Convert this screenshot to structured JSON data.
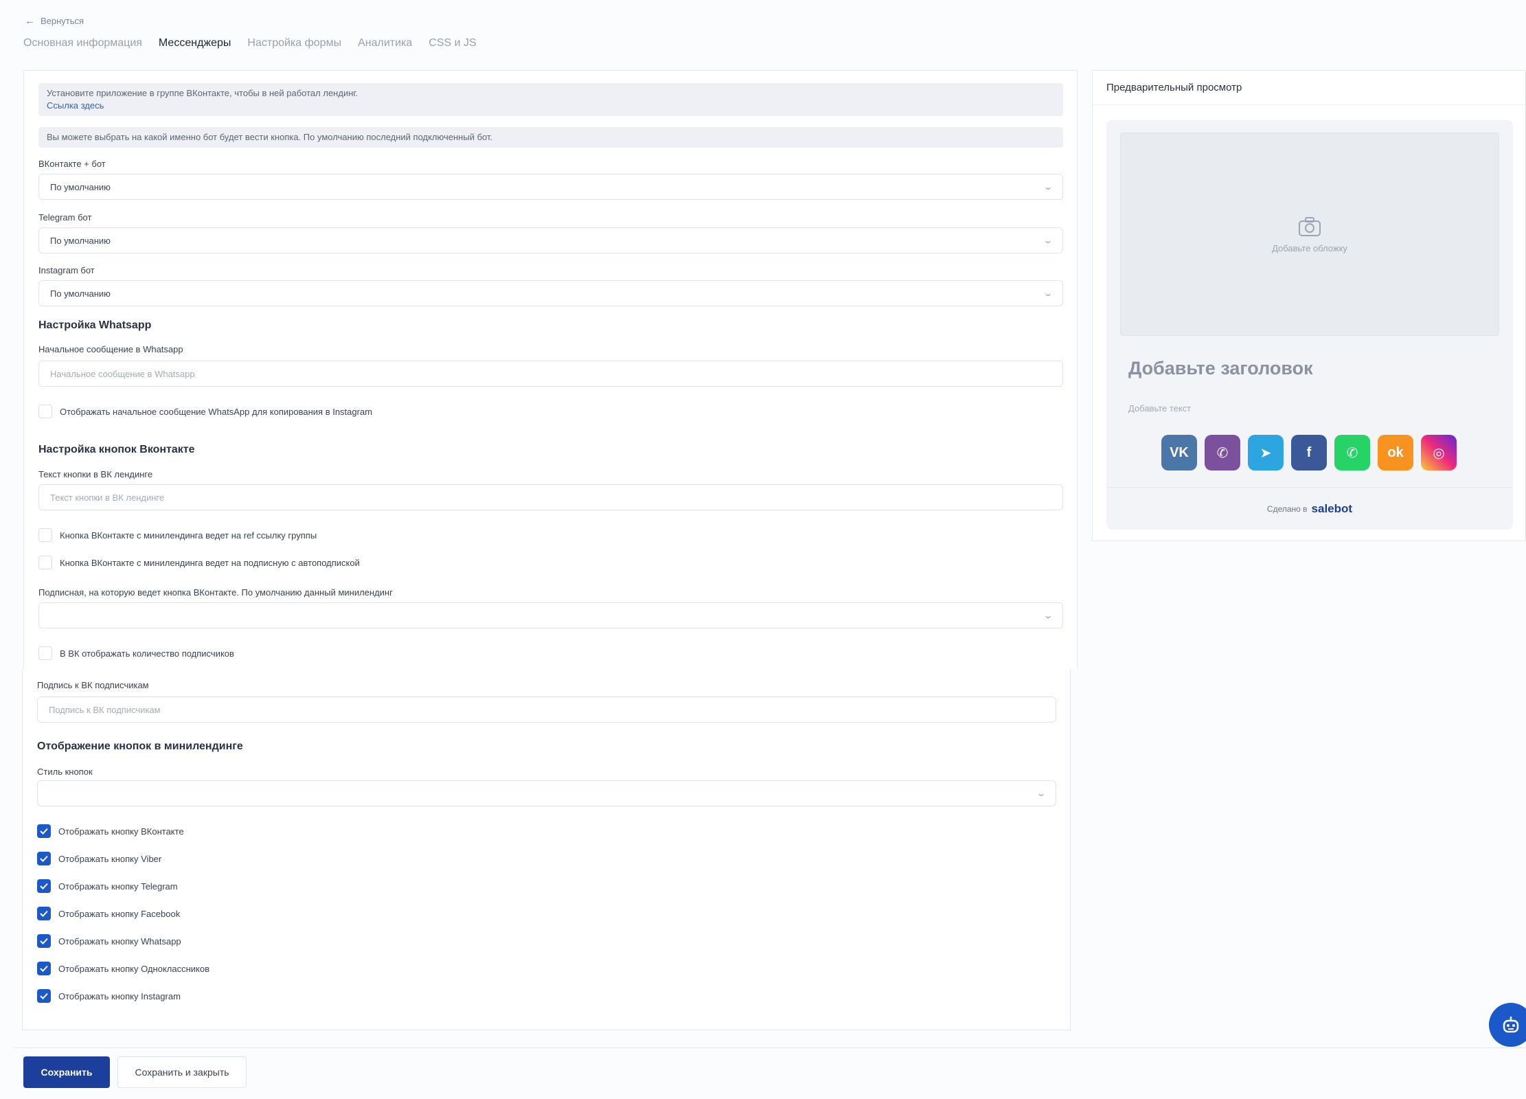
{
  "nav": {
    "back": "Вернуться"
  },
  "tabs": [
    {
      "label": "Основная информация",
      "active": false
    },
    {
      "label": "Мессенджеры",
      "active": true
    },
    {
      "label": "Настройка формы",
      "active": false
    },
    {
      "label": "Аналитика",
      "active": false
    },
    {
      "label": "CSS и JS",
      "active": false
    }
  ],
  "info": {
    "install_text": "Установите приложение в группе ВКонтакте, чтобы в ней работал лендинг.",
    "install_link": "Ссылка здесь",
    "bot_choice_text": "Вы можете выбрать на какой именно бот будет вести кнопка. По умолчанию последний подключенный бот."
  },
  "bots": {
    "vk": {
      "label": "ВКонтакте + бот",
      "value": "По умолчанию"
    },
    "telegram": {
      "label": "Telegram бот",
      "value": "По умолчанию"
    },
    "instagram": {
      "label": "Instagram бот",
      "value": "По умолчанию"
    }
  },
  "whatsapp": {
    "title": "Настройка Whatsapp",
    "start_label": "Начальное сообщение в Whatsapp",
    "start_placeholder": "Начальное сообщение в Whatsapp",
    "copy_checkbox": "Отображать начальное сообщение WhatsApp для копирования в Instagram"
  },
  "vk_buttons": {
    "title": "Настройка кнопок Вконтакте",
    "text_label": "Текст кнопки в ВК лендинге",
    "text_placeholder": "Текст кнопки в ВК лендинге",
    "ref_checkbox": "Кнопка ВКонтакте с минилендинга ведет на ref ссылку группы",
    "autosub_checkbox": "Кнопка ВКонтакте с минилендинга ведет на подписную с автоподпиской",
    "subpage_label": "Подписная, на которую ведет кнопка ВКонтакте. По умолчанию данный минилендинг",
    "subpage_value": "",
    "count_checkbox": "В ВК отображать количество подписчиков",
    "caption_label": "Подпись к ВК подписчикам",
    "caption_placeholder": "Подпись к ВК подписчикам"
  },
  "display": {
    "title": "Отображение кнопок в минилендинге",
    "style_label": "Стиль кнопок",
    "style_value": "",
    "checkboxes": [
      {
        "label": "Отображать кнопку ВКонтакте",
        "checked": true
      },
      {
        "label": "Отображать кнопку Viber",
        "checked": true
      },
      {
        "label": "Отображать кнопку Telegram",
        "checked": true
      },
      {
        "label": "Отображать кнопку Facebook",
        "checked": true
      },
      {
        "label": "Отображать кнопку Whatsapp",
        "checked": true
      },
      {
        "label": "Отображать кнопку Одноклассников",
        "checked": true
      },
      {
        "label": "Отображать кнопку Instagram",
        "checked": true
      }
    ]
  },
  "preview": {
    "title": "Предварительный просмотр",
    "cover_text": "Добавьте обложку",
    "heading": "Добавьте заголовок",
    "text": "Добавьте текст",
    "made_in": "Сделано в",
    "brand": "salebot",
    "social": [
      {
        "name": "vk-icon",
        "glyph": "VK",
        "color": "#4a76a8"
      },
      {
        "name": "viber-icon",
        "glyph": "✆",
        "color": "#7b519d"
      },
      {
        "name": "telegram-icon",
        "glyph": "➤",
        "color": "#2ca5e0"
      },
      {
        "name": "facebook-icon",
        "glyph": "f",
        "color": "#3b5998"
      },
      {
        "name": "whatsapp-icon",
        "glyph": "✆",
        "color": "#25d366"
      },
      {
        "name": "odnoklassniki-icon",
        "glyph": "ok",
        "color": "#f7931e"
      },
      {
        "name": "instagram-icon",
        "glyph": "◎",
        "color": "#c13584"
      }
    ]
  },
  "actions": {
    "save": "Сохранить",
    "save_close": "Сохранить и закрыть"
  }
}
